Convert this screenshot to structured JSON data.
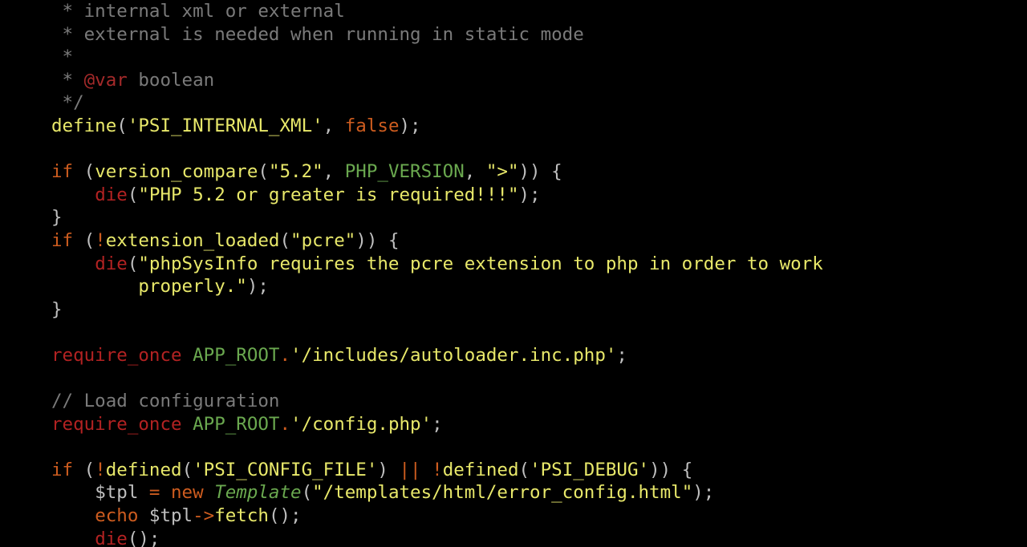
{
  "code": {
    "c1": " * internal xml or external",
    "c2": " * external is needed when running in static mode",
    "c3": " *",
    "c4a": " * ",
    "c4tag": "@var",
    "c4b": " boolean",
    "c5": " */",
    "l6": {
      "define": "define",
      "q": "'",
      "psi": "PSI_INTERNAL_XML",
      "false": "false"
    },
    "l8": {
      "if": "if",
      "vc": "version_compare",
      "s1": "\"5.2\"",
      "pv": "PHP_VERSION",
      "s2": "\">\""
    },
    "l9": {
      "die": "die",
      "s": "\"PHP 5.2 or greater is required!!!\""
    },
    "l11": {
      "if": "if",
      "el": "extension_loaded",
      "s": "\"pcre\""
    },
    "l12": {
      "die": "die",
      "s1": "\"phpSysInfo requires the pcre extension to php in order to work",
      "s2": "        properly.\""
    },
    "l16": {
      "ro": "require_once",
      "ar": "APP_ROOT",
      "dot": ".",
      "s": "'/includes/autoloader.inc.php'"
    },
    "l18": "// Load configuration",
    "l19": {
      "ro": "require_once",
      "ar": "APP_ROOT",
      "dot": ".",
      "s": "'/config.php'"
    },
    "l21": {
      "if": "if",
      "not": "!",
      "def": "defined",
      "s1": "'PSI_CONFIG_FILE'",
      "or": "||",
      "s2": "'PSI_DEBUG'"
    },
    "l22": {
      "var": "$tpl",
      "eq": "=",
      "new": "new",
      "T": "Template",
      "s": "\"/templates/html/error_config.html\""
    },
    "l23": {
      "echo": "echo",
      "var": "$tpl",
      "arrow": "->",
      "fetch": "fetch"
    },
    "l24": {
      "die": "die"
    }
  }
}
